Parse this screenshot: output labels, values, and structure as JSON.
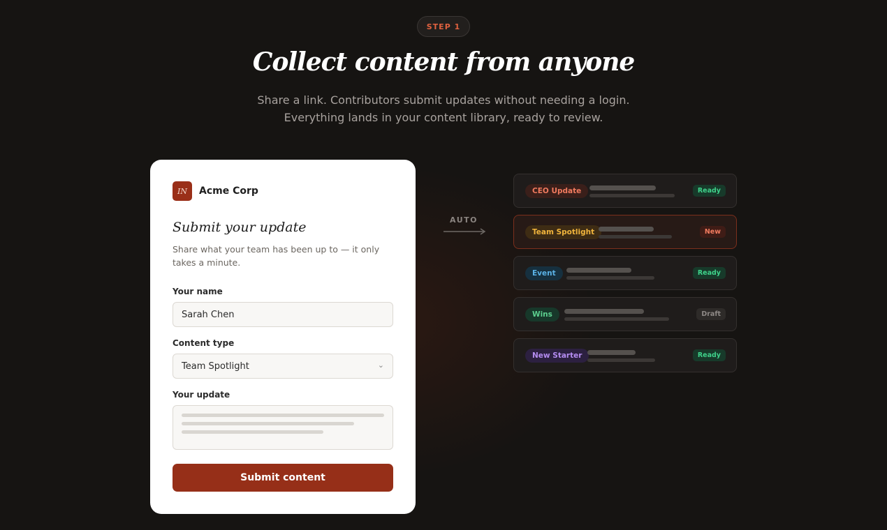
{
  "header": {
    "step": "STEP 1",
    "title": "Collect content from anyone",
    "subtitle_line1": "Share a link. Contributors submit updates without needing a login.",
    "subtitle_line2": "Everything lands in your content library, ready to review."
  },
  "form": {
    "brand_initials": "IN",
    "brand_name": "Acme Corp",
    "title": "Submit your update",
    "description": "Share what your team has been up to — it only takes a minute.",
    "name_label": "Your name",
    "name_value": "Sarah Chen",
    "type_label": "Content type",
    "type_value": "Team Spotlight",
    "update_label": "Your update",
    "submit_label": "Submit content"
  },
  "flow": {
    "auto_label": "AUTO"
  },
  "library": {
    "items": [
      {
        "tag": "CEO Update",
        "status": "Ready"
      },
      {
        "tag": "Team Spotlight",
        "status": "New"
      },
      {
        "tag": "Event",
        "status": "Ready"
      },
      {
        "tag": "Wins",
        "status": "Draft"
      },
      {
        "tag": "New Starter",
        "status": "Ready"
      }
    ]
  },
  "colors": {
    "accent": "#962f18",
    "tag_ceo": "#f07a5e",
    "tag_spotlight": "#f0b43c",
    "tag_event": "#5bb2e6",
    "tag_wins": "#5ccf8e",
    "tag_starter": "#b48cf0",
    "status_ready": "#3fd18a",
    "status_new": "#f07a5e",
    "status_draft": "#8e8986"
  }
}
